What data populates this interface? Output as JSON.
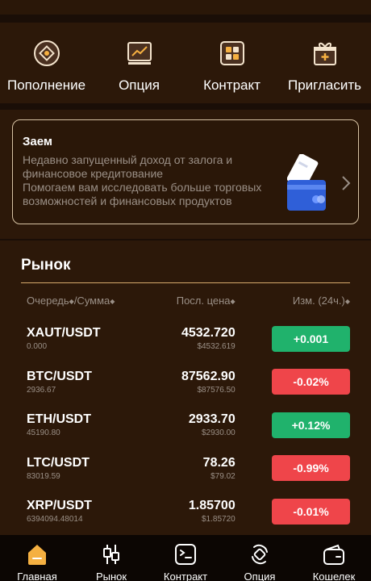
{
  "quick_actions": [
    {
      "label": "Пополнение",
      "icon": "deposit-icon"
    },
    {
      "label": "Опция",
      "icon": "chart-option-icon"
    },
    {
      "label": "Контракт",
      "icon": "contract-grid-icon"
    },
    {
      "label": "Пригласить",
      "icon": "gift-icon"
    }
  ],
  "loan": {
    "title": "Заем",
    "line1": "Недавно запущенный доход от залога и финансовое кредитование",
    "line2": "Помогаем вам исследовать больше торговых возможностей и финансовых продуктов"
  },
  "market": {
    "title": "Рынок",
    "headers": {
      "pair": "Очередь",
      "sum": "/Сумма",
      "price": "Посл. цена",
      "change": "Изм. (24ч.)"
    },
    "rows": [
      {
        "pair": "XAUT/USDT",
        "volume": "0.000",
        "price": "4532.720",
        "usd": "$4532.619",
        "change": "+0.001",
        "dir": "up"
      },
      {
        "pair": "BTC/USDT",
        "volume": "2936.67",
        "price": "87562.90",
        "usd": "$87576.50",
        "change": "-0.02%",
        "dir": "down"
      },
      {
        "pair": "ETH/USDT",
        "volume": "45190.80",
        "price": "2933.70",
        "usd": "$2930.00",
        "change": "+0.12%",
        "dir": "up"
      },
      {
        "pair": "LTC/USDT",
        "volume": "83019.59",
        "price": "78.26",
        "usd": "$79.02",
        "change": "-0.99%",
        "dir": "down"
      },
      {
        "pair": "XRP/USDT",
        "volume": "6394094.48014",
        "price": "1.85700",
        "usd": "$1.85720",
        "change": "-0.01%",
        "dir": "down"
      }
    ]
  },
  "tabs": [
    {
      "label": "Главная",
      "icon": "home-icon",
      "active": true
    },
    {
      "label": "Рынок",
      "icon": "candlestick-icon"
    },
    {
      "label": "Контракт",
      "icon": "contract-icon"
    },
    {
      "label": "Опция",
      "icon": "option-icon"
    },
    {
      "label": "Кошелек",
      "icon": "wallet-icon"
    }
  ],
  "colors": {
    "up": "#20b26c",
    "down": "#ef454a",
    "accent": "#f5b041",
    "panel": "#2c1809"
  }
}
